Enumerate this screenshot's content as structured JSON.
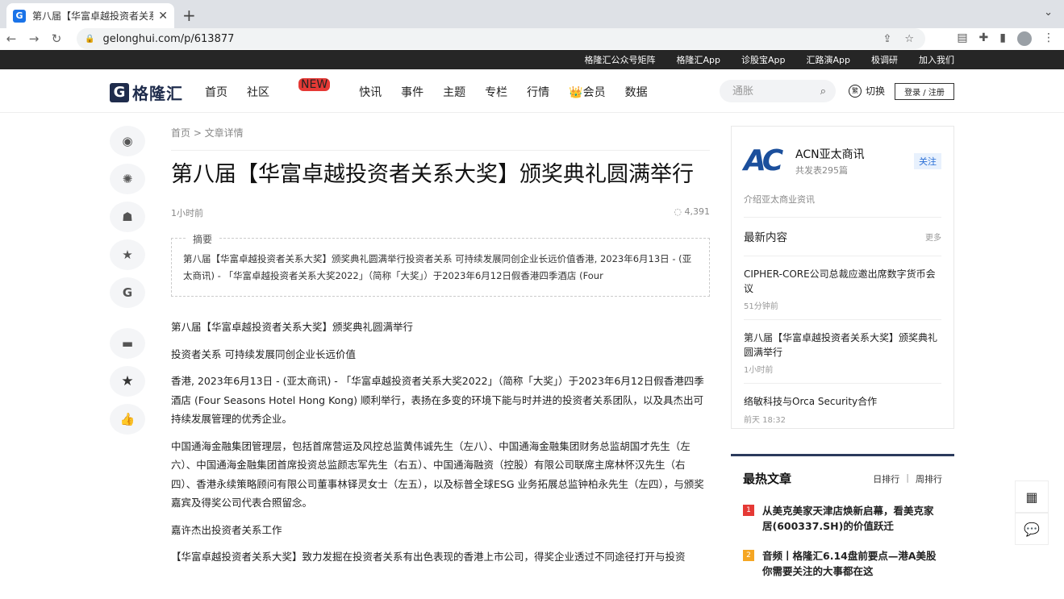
{
  "browser": {
    "tab_title": "第八届【华富卓越投资者关系大奖",
    "url": "gelonghui.com/p/613877"
  },
  "topbar": [
    "格隆汇公众号矩阵",
    "格隆汇App",
    "诊股宝App",
    "汇路演App",
    "极调研",
    "加入我们"
  ],
  "header": {
    "logo_mark": "G",
    "logo_text": "格隆汇",
    "nav": [
      "首页",
      "社区",
      "快讯",
      "事件",
      "主题",
      "专栏",
      "行情",
      "👑会员",
      "数据"
    ],
    "new_badge": "NEW",
    "search_placeholder": "通胀",
    "switch_icon": "繁",
    "switch_label": "切换",
    "login_label": "登录 / 注册"
  },
  "rail": {
    "icons": [
      "weibo-icon",
      "wechat-moments-icon",
      "qq-icon",
      "favorite-icon",
      "gelonghui-icon",
      "comment-icon",
      "star-icon",
      "thumbs-up-icon"
    ],
    "g_glyph": "G"
  },
  "article": {
    "breadcrumb": "首页 > 文章详情",
    "title": "第八届【华富卓越投资者关系大奖】颁奖典礼圆满举行",
    "time": "1小时前",
    "views": "4,391",
    "summary_label": "摘要",
    "summary": "第八届【华富卓越投资者关系大奖】颁奖典礼圆满举行投资者关系 可持续发展同创企业长远价值香港, 2023年6月13日 - (亚太商讯) - 「华富卓越投资者关系大奖2022」（简称「大奖」）于2023年6月12日假香港四季酒店 (Four",
    "paragraphs": [
      "第八届【华富卓越投资者关系大奖】颁奖典礼圆满举行",
      "投资者关系 可持续发展同创企业长远价值",
      "香港, 2023年6月13日 - (亚太商讯) - 「华富卓越投资者关系大奖2022」（简称「大奖」）于2023年6月12日假香港四季酒店 (Four Seasons Hotel Hong Kong) 顺利举行，表扬在多变的环境下能与时并进的投资者关系团队，以及具杰出可持续发展管理的优秀企业。",
      "中国通海金融集团管理层，包括首席营运及风控总监黄伟诚先生（左八）、中国通海金融集团财务总监胡国才先生（左六）、中国通海金融集团首席投资总监颜志军先生（右五）、中国通海融资（控股）有限公司联席主席林怀汉先生（右四）、香港永续策略顾问有限公司董事林铎灵女士（左五），以及标普全球ESG 业务拓展总监钟柏永先生（左四），与颁奖嘉宾及得奖公司代表合照留念。",
      "嘉许杰出投资者关系工作",
      "【华富卓越投资者关系大奖】致力发掘在投资者关系有出色表现的香港上市公司，得奖企业透过不同途径打开与投资"
    ]
  },
  "author": {
    "logo": "AC",
    "name": "ACN亚太商讯",
    "count": "共发表295篇",
    "follow": "关注",
    "intro": "介绍亚太商业资讯",
    "latest_title": "最新内容",
    "more": "更多",
    "latest": [
      {
        "title": "CIPHER-CORE公司总裁应邀出席数字货币会议",
        "time": "51分钟前"
      },
      {
        "title": "第八届【华富卓越投资者关系大奖】颁奖典礼圆满举行",
        "time": "1小时前"
      },
      {
        "title": "络敏科技与Orca Security合作",
        "time": "前天 18:32"
      }
    ]
  },
  "hot": {
    "title": "最热文章",
    "tab_day": "日排行",
    "tab_sep": "|",
    "tab_week": "周排行",
    "items": [
      {
        "rank": "1",
        "title": "从美克美家天津店焕新启幕，看美克家居(600337.SH)的价值跃迁",
        "color": "#e53935"
      },
      {
        "rank": "2",
        "title": "音频丨格隆汇6.14盘前要点—港A美股你需要关注的大事都在这",
        "color": "#f5a623"
      }
    ]
  },
  "float_tools": [
    "qrcode-icon",
    "feedback-icon"
  ]
}
